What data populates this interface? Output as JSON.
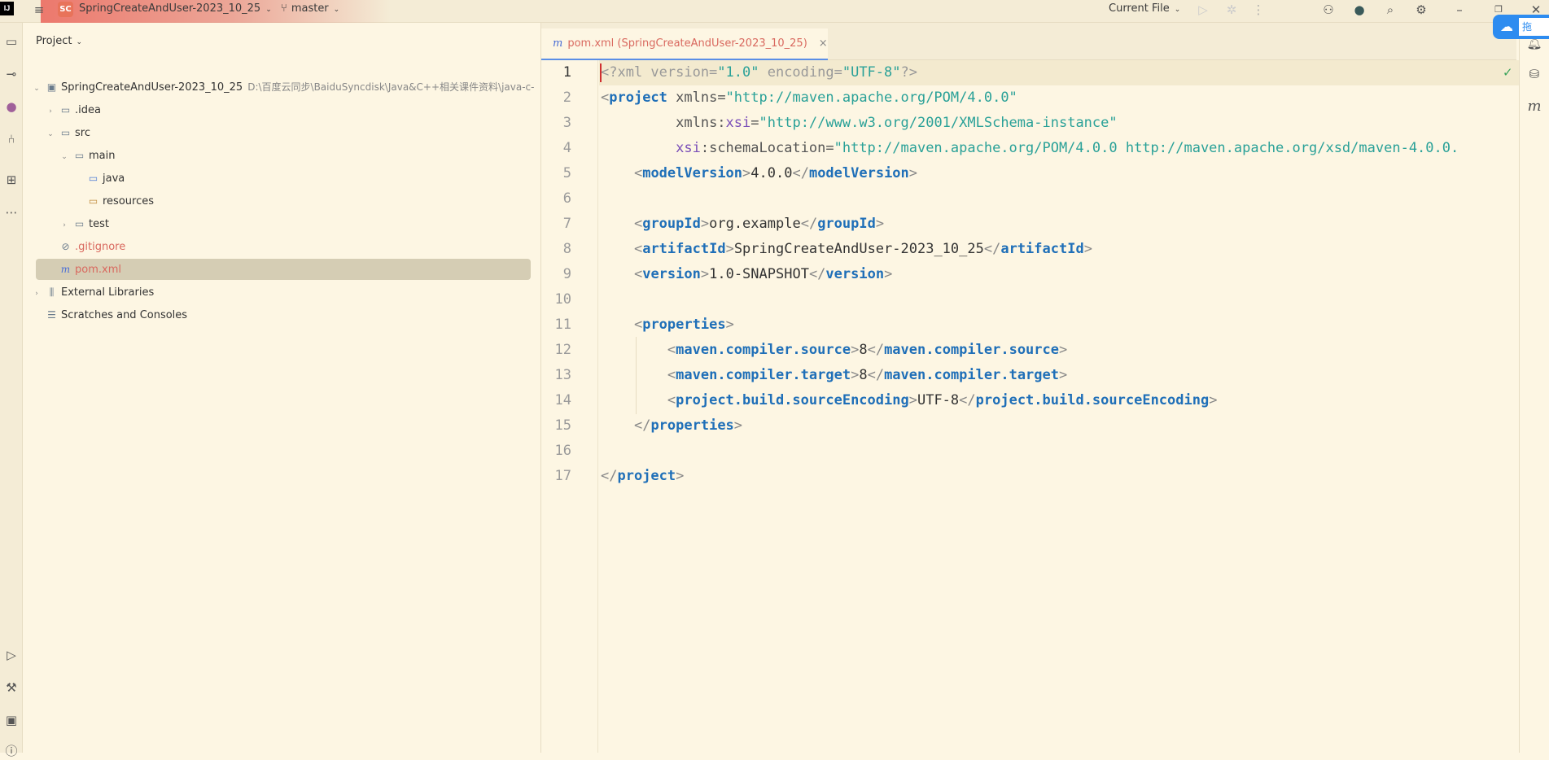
{
  "titlebar": {
    "app_logo": "IJ",
    "project_badge": "SC",
    "project_name": "SpringCreateAndUser-2023_10_25",
    "branch": "master",
    "run_config": "Current File",
    "icons": [
      "hamburger-menu-icon",
      "branch-icon",
      "run-icon",
      "debug-icon",
      "more-icon",
      "add-user-icon",
      "copilot-icon",
      "search-icon",
      "settings-icon",
      "minimize-icon",
      "restore-icon",
      "close-icon"
    ]
  },
  "project_panel": {
    "title": "Project",
    "tree": [
      {
        "label": "SpringCreateAndUser-2023_10_25",
        "path": "D:\\百度云同步\\BaiduSyncdisk\\Java&C++相关课件资料\\java-c-",
        "icon": "module-icon",
        "level": 0
      },
      {
        "label": ".idea",
        "icon": "folder-icon",
        "level": 1
      },
      {
        "label": "src",
        "icon": "folder-icon",
        "level": 1
      },
      {
        "label": "main",
        "icon": "folder-icon",
        "level": 2
      },
      {
        "label": "java",
        "icon": "source-folder-icon",
        "level": 3
      },
      {
        "label": "resources",
        "icon": "resources-folder-icon",
        "level": 3
      },
      {
        "label": "test",
        "icon": "folder-icon",
        "level": 2
      },
      {
        "label": ".gitignore",
        "icon": "ignore-file-icon",
        "level": 1
      },
      {
        "label": "pom.xml",
        "icon": "maven-icon",
        "level": 1,
        "selected": true
      },
      {
        "label": "External Libraries",
        "icon": "libraries-icon",
        "level": 0
      },
      {
        "label": "Scratches and Consoles",
        "icon": "scratches-icon",
        "level": 0
      }
    ]
  },
  "editor": {
    "tab_icon": "m",
    "tab_label": "pom.xml (SpringCreateAndUser-2023_10_25)",
    "tab_close": "×",
    "line_numbers": [
      "1",
      "2",
      "3",
      "4",
      "5",
      "6",
      "7",
      "8",
      "9",
      "10",
      "11",
      "12",
      "13",
      "14",
      "15",
      "16",
      "17"
    ],
    "code": {
      "l1_a": "<?xml version=",
      "l1_v1": "\"1.0\"",
      "l1_b": " encoding=",
      "l1_v2": "\"UTF-8\"",
      "l1_c": "?>",
      "l2_open": "<",
      "l2_tag": "project",
      "l2_attr": " xmlns=",
      "l2_val": "\"http://maven.apache.org/POM/4.0.0\"",
      "l3_attr": "xmlns:",
      "l3_ns": "xsi",
      "l3_eq": "=",
      "l3_val": "\"http://www.w3.org/2001/XMLSchema-instance\"",
      "l4_ns": "xsi",
      "l4_attr": ":schemaLocation=",
      "l4_val": "\"http://maven.apache.org/POM/4.0.0 http://maven.apache.org/xsd/maven-4.0.0.",
      "l5_tag": "modelVersion",
      "l5_text": "4.0.0",
      "l7_tag": "groupId",
      "l7_text": "org.example",
      "l8_tag": "artifactId",
      "l8_text": "SpringCreateAndUser-2023_10_25",
      "l9_tag": "version",
      "l9_text": "1.0-SNAPSHOT",
      "l11_tag": "properties",
      "l12_tag": "maven.compiler.source",
      "l12_text": "8",
      "l13_tag": "maven.compiler.target",
      "l13_text": "8",
      "l14_tag": "project.build.sourceEncoding",
      "l14_text": "UTF-8",
      "l15_tag": "properties",
      "l17_tag": "project"
    }
  },
  "right_strip": {
    "baidu_label": "拖",
    "icons": [
      "notifications-icon",
      "database-icon",
      "maven-icon"
    ],
    "maven_glyph": "m"
  }
}
